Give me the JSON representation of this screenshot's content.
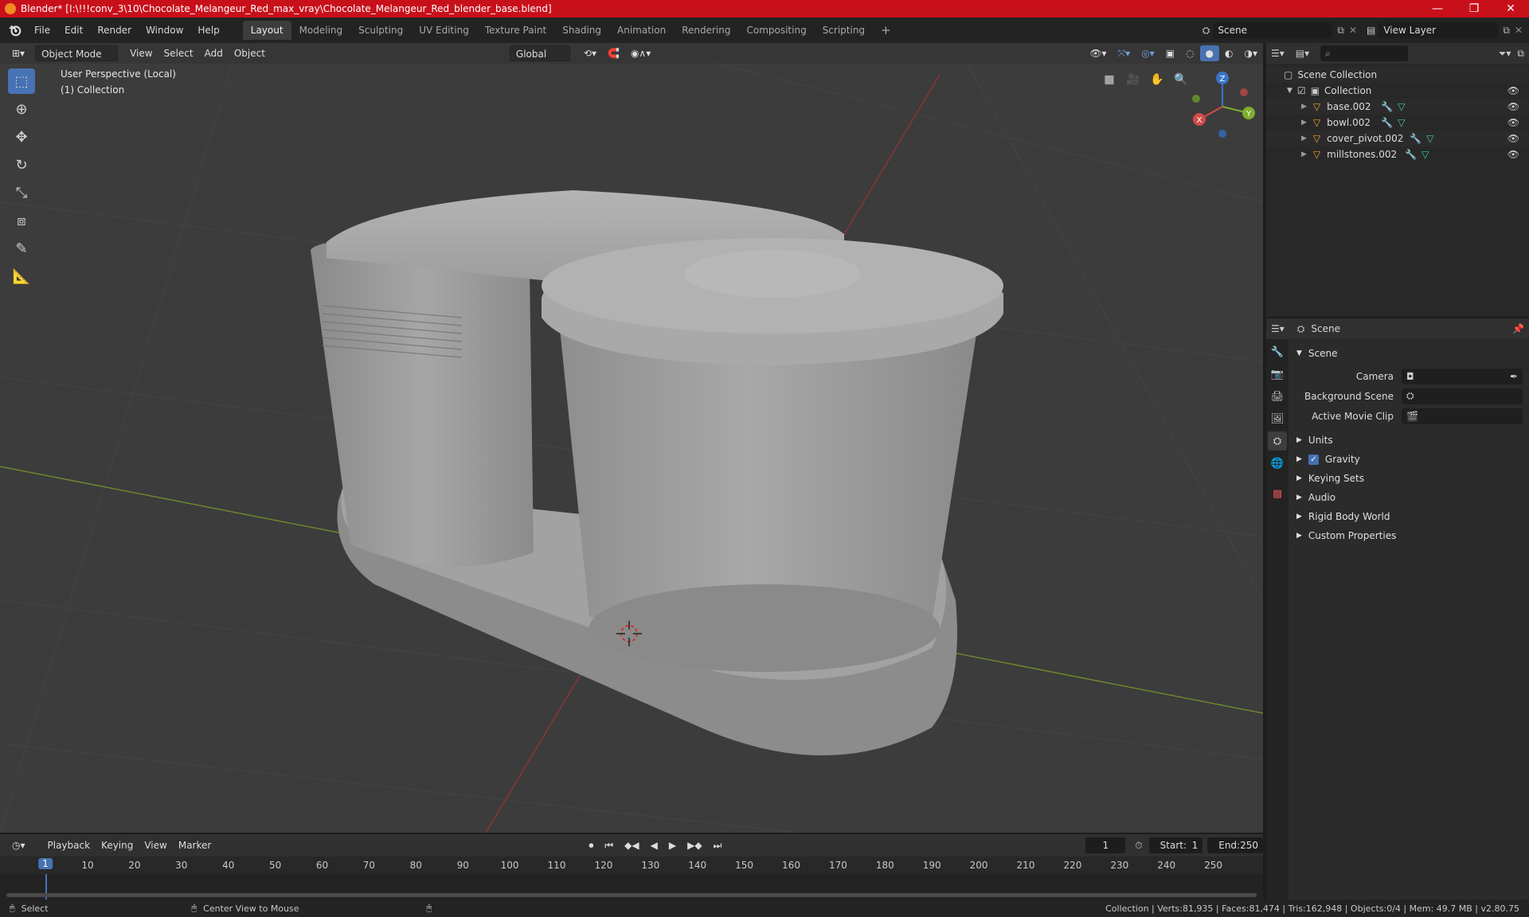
{
  "window": {
    "title": "Blender* [I:\\!!!conv_3\\10\\Chocolate_Melangeur_Red_max_vray\\Chocolate_Melangeur_Red_blender_base.blend]",
    "min": "—",
    "max": "❐",
    "close": "✕"
  },
  "menu": {
    "file": "File",
    "edit": "Edit",
    "render": "Render",
    "window": "Window",
    "help": "Help"
  },
  "workspaces": [
    "Layout",
    "Modeling",
    "Sculpting",
    "UV Editing",
    "Texture Paint",
    "Shading",
    "Animation",
    "Rendering",
    "Compositing",
    "Scripting"
  ],
  "scene_field": "Scene",
  "view_layer_field": "View Layer",
  "viewport": {
    "mode": "Object Mode",
    "menus": {
      "view": "View",
      "select": "Select",
      "add": "Add",
      "object": "Object"
    },
    "orientation": "Global",
    "perspective_label": "User Perspective (Local)",
    "collection_label": "(1) Collection",
    "gizmo": {
      "z": "Z",
      "y": "Y",
      "x": "X"
    }
  },
  "outliner": {
    "root": "Scene Collection",
    "collection": "Collection",
    "items": [
      "base.002",
      "bowl.002",
      "cover_pivot.002",
      "millstones.002"
    ]
  },
  "properties": {
    "header_title": "Scene",
    "section_scene": "Scene",
    "camera_label": "Camera",
    "background_scene_label": "Background Scene",
    "active_movie_clip_label": "Active Movie Clip",
    "sections": [
      "Units",
      "Gravity",
      "Keying Sets",
      "Audio",
      "Rigid Body World",
      "Custom Properties"
    ]
  },
  "timeline": {
    "menus": {
      "playback": "Playback",
      "keying": "Keying",
      "view": "View",
      "marker": "Marker"
    },
    "current_frame": "1",
    "start_label": "Start:",
    "start": "1",
    "end_label": "End:",
    "end": "250",
    "ticks": [
      "1",
      "10",
      "20",
      "30",
      "40",
      "50",
      "60",
      "70",
      "80",
      "90",
      "100",
      "110",
      "120",
      "130",
      "140",
      "150",
      "160",
      "170",
      "180",
      "190",
      "200",
      "210",
      "220",
      "230",
      "240",
      "250"
    ]
  },
  "status": {
    "select": "Select",
    "center": "Center View to Mouse",
    "stats": "Collection | Verts:81,935 | Faces:81,474 | Tris:162,948 | Objects:0/4 | Mem: 49.7 MB | v2.80.75"
  }
}
